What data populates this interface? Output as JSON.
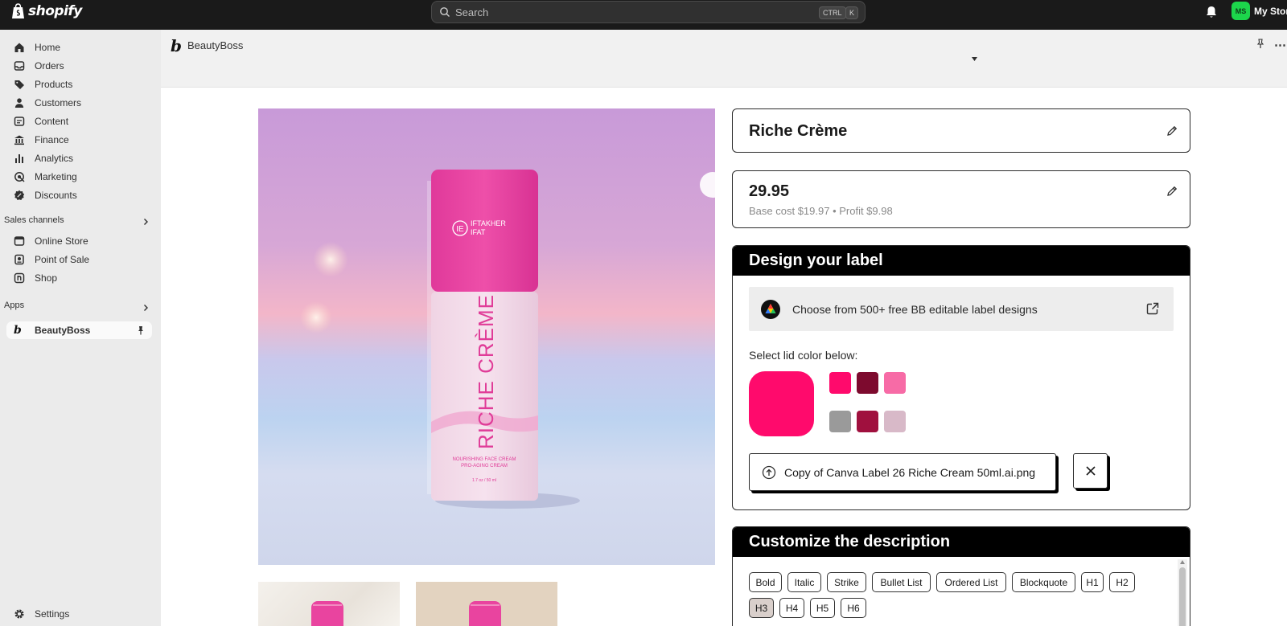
{
  "topbar": {
    "brand": "shopify",
    "search_placeholder": "Search",
    "kbd_ctrl": "CTRL",
    "kbd_k": "K",
    "avatar_initials": "MS",
    "store_name": "My Store"
  },
  "sidebar": {
    "items": [
      {
        "label": "Home",
        "icon": "home-icon"
      },
      {
        "label": "Orders",
        "icon": "inbox-icon"
      },
      {
        "label": "Products",
        "icon": "tag-icon"
      },
      {
        "label": "Customers",
        "icon": "person-icon"
      },
      {
        "label": "Content",
        "icon": "image-icon"
      },
      {
        "label": "Finance",
        "icon": "bank-icon"
      },
      {
        "label": "Analytics",
        "icon": "bar-chart-icon"
      },
      {
        "label": "Marketing",
        "icon": "target-icon"
      },
      {
        "label": "Discounts",
        "icon": "badge-icon"
      }
    ],
    "sales_channels_title": "Sales channels",
    "sales_channels": [
      {
        "label": "Online Store",
        "icon": "store-icon"
      },
      {
        "label": "Point of Sale",
        "icon": "pos-icon"
      },
      {
        "label": "Shop",
        "icon": "shop-icon"
      }
    ],
    "apps_title": "Apps",
    "apps": [
      {
        "label": "BeautyBoss",
        "icon": "beautyboss-logo-icon"
      }
    ],
    "settings_label": "Settings"
  },
  "app_header": {
    "title": "BeautyBoss",
    "more": "⋯"
  },
  "product": {
    "name": "Riche Crème",
    "price": "29.95",
    "cost_line": "Base cost $19.97 • Profit $9.98",
    "bottle_brand_line1": "IFTAKHER",
    "bottle_brand_line2": "IFAT",
    "bottle_monogram": "IE",
    "bottle_title": "RICHE CRÈME",
    "bottle_sub1": "NOURISHING FACE CREAM",
    "bottle_sub2": "PRO-AGING CREAM",
    "bottle_size": "1.7 oz / 50 ml"
  },
  "design": {
    "title": "Design your label",
    "canva_text": "Choose from 500+ free BB editable label designs",
    "lid_label": "Select lid color below:",
    "selected_color": "#ff0a6c",
    "swatches": [
      "#ff0a6c",
      "#7d0a2e",
      "#f76ba6",
      "#9a9a9a",
      "#a0103e",
      "#d8b9c8"
    ],
    "file_name": "Copy of Canva Label 26 Riche Cream 50ml.ai.png"
  },
  "description": {
    "title": "Customize the description",
    "toolbar_row1": [
      "Bold",
      "Italic",
      "Strike",
      "Bullet List",
      "Ordered List",
      "Blockquote",
      "H1",
      "H2"
    ],
    "toolbar_row2": [
      "H3",
      "H4",
      "H5",
      "H6"
    ],
    "pressed": "H3"
  }
}
